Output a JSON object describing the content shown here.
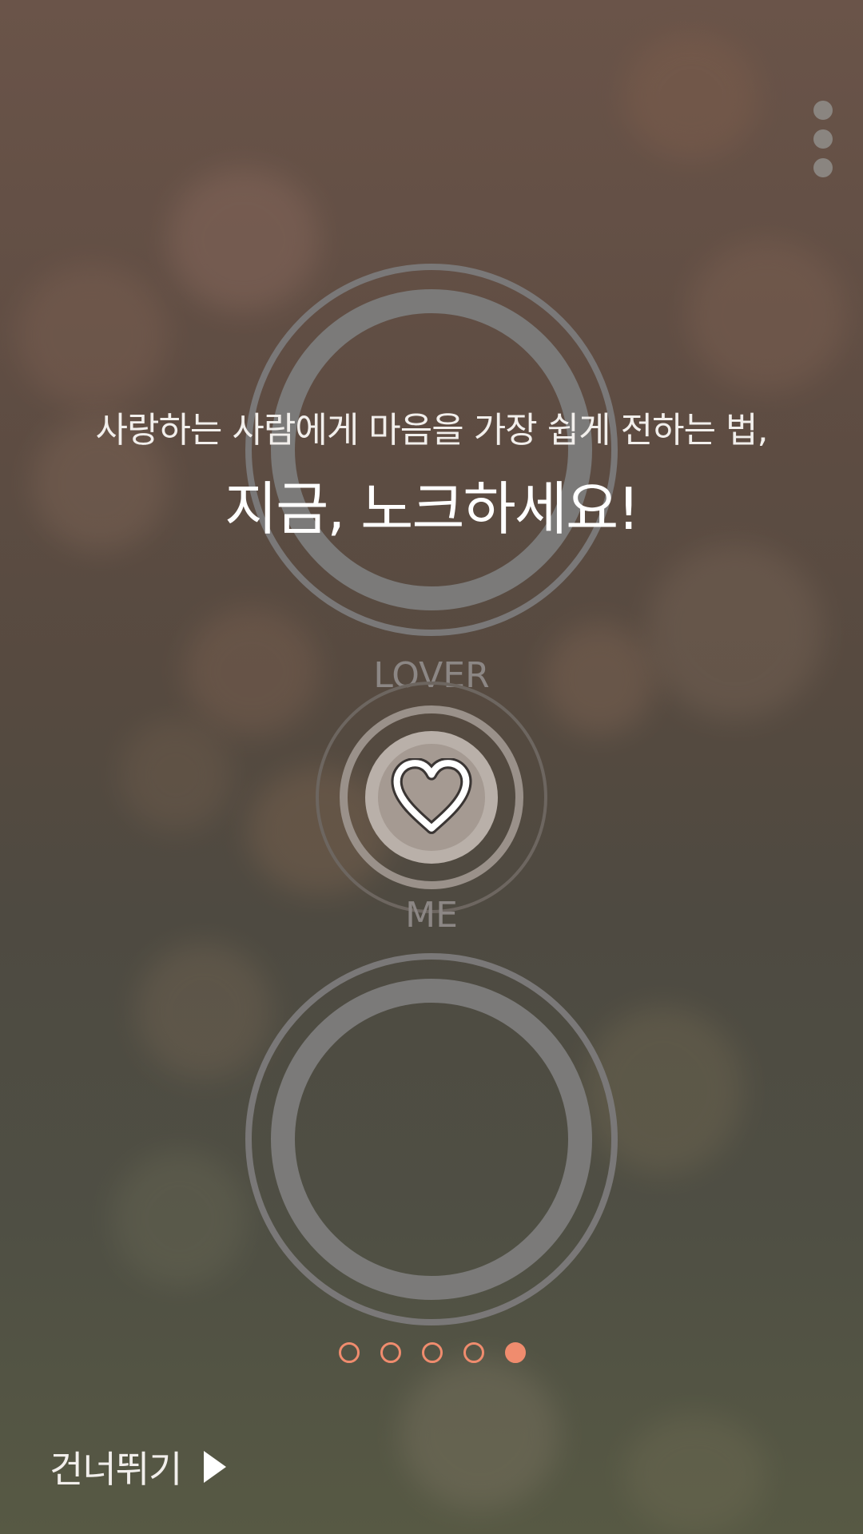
{
  "intro": {
    "subtitle": "사랑하는 사람에게 마음을 가장 쉽게 전하는 법,",
    "headline": "지금, 노크하세요!"
  },
  "rings": {
    "lover_label": "LOVER",
    "me_label": "ME",
    "center_icon": "heart-icon"
  },
  "pager": {
    "total_pages": 5,
    "current_page": 5,
    "accent_color": "#f08c6e"
  },
  "footer": {
    "skip_label": "건너뛰기",
    "skip_icon": "play-arrow-icon"
  },
  "menu": {
    "icon": "more-vertical-icon"
  }
}
